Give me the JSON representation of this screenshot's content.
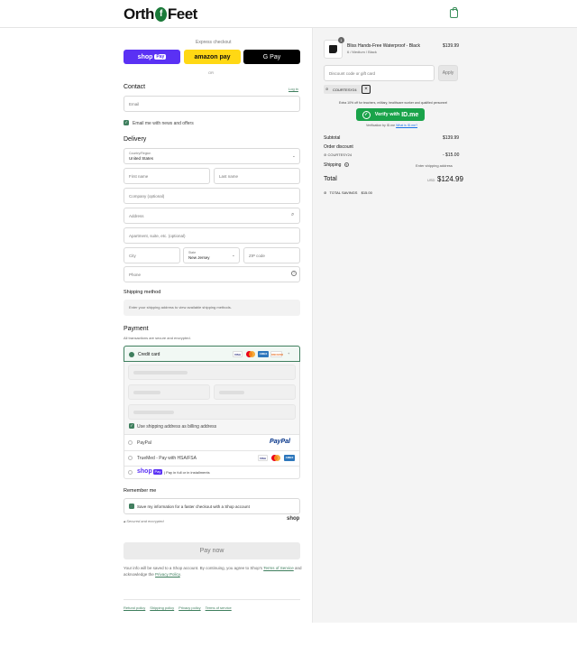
{
  "header": {
    "logo_left": "Orth",
    "logo_mark": "f",
    "logo_right": "Feet"
  },
  "express": {
    "title": "Express checkout",
    "shop_pay": "shop",
    "shop_pay_badge": "Pay",
    "amazon_pay": "amazon pay",
    "google_pay": "G Pay",
    "or": "OR"
  },
  "contact": {
    "title": "Contact",
    "login": "Log in",
    "email_placeholder": "Email",
    "news_label": "Email me with news and offers"
  },
  "delivery": {
    "title": "Delivery",
    "country_label": "Country/Region",
    "country_value": "United States",
    "first_name": "First name",
    "last_name": "Last name",
    "company": "Company (optional)",
    "address": "Address",
    "apartment": "Apartment, suite, etc. (optional)",
    "city": "City",
    "state_label": "State",
    "state_value": "New Jersey",
    "zip": "ZIP code",
    "phone": "Phone"
  },
  "shipping_method": {
    "title": "Shipping method",
    "notice": "Enter your shipping address to view available shipping methods."
  },
  "payment": {
    "title": "Payment",
    "subtitle": "All transactions are secure and encrypted.",
    "credit_card": "Credit card",
    "cards": [
      "VISA",
      "MC",
      "AMEX",
      "DISCOVER"
    ],
    "more_cards": "+",
    "billing_label": "Use shipping address as billing address",
    "paypal": "PayPal",
    "paypal_logo": "PayPal",
    "truemed": "TrueMed - Pay with HSA/FSA",
    "shoppay_text": "| Pay in full or in installments",
    "shoppay_logo": "shop",
    "shoppay_badge": "Pay"
  },
  "remember": {
    "title": "Remember me",
    "label": "Save my information for a faster checkout with a Shop account",
    "secure": "Secured and encrypted",
    "shop_logo": "shop"
  },
  "pay_now": "Pay now",
  "legal": {
    "text_1": "Your info will be saved to a Shop account. By continuing, you agree to Shop's",
    "terms": "Terms of Service",
    "text_2": "and acknowledge the",
    "privacy": "Privacy Policy",
    "text_3": "."
  },
  "footer_links": [
    "Refund policy",
    "Shipping policy",
    "Privacy policy",
    "Terms of service"
  ],
  "summary": {
    "product_name": "Bliss Hands-Free Waterproof - Black",
    "product_variant": "6 / Medium / Black",
    "product_qty": "1",
    "product_price": "$139.99",
    "discount_placeholder": "Discount code or gift card",
    "apply": "Apply",
    "code": "COURTESY24",
    "remove": "×",
    "idme_note": "Extra 10% off for teachers, military, healthcare worker and qualified personnel",
    "idme_button_pre": "Verify with",
    "idme_button_brand": "ID.me",
    "idme_verify": "Verification by ID.me",
    "idme_link": "What is ID.me?",
    "subtotal_label": "Subtotal",
    "subtotal_value": "$139.99",
    "order_discount_label": "Order discount",
    "discount_code": "COURTESY24",
    "discount_value": "- $15.00",
    "shipping_label": "Shipping",
    "shipping_value": "Enter shipping address",
    "total_label": "Total",
    "currency": "USD",
    "total_value": "$124.99",
    "savings_label": "TOTAL SAVINGS",
    "savings_value": "$15.00"
  },
  "colors": {
    "accent": "#3f7f5e",
    "shop_pay": "#5a31f4",
    "amazon": "#ffd814",
    "idme": "#1aa34a"
  }
}
